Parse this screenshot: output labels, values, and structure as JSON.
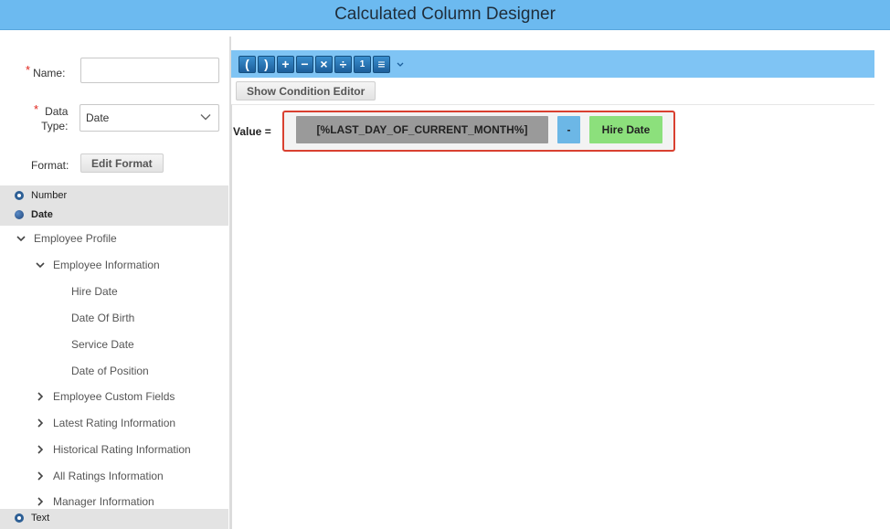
{
  "window": {
    "title": "Calculated Column Designer"
  },
  "form": {
    "name_label": "Name:",
    "name_value": "",
    "data_type_label_line1": "Data",
    "data_type_label_line2": "Type:",
    "data_type_value": "Date",
    "format_label": "Format:",
    "edit_format_button": "Edit Format"
  },
  "field_types": [
    {
      "label": "Number",
      "selected": false
    },
    {
      "label": "Date",
      "selected": true
    },
    {
      "label": "Text",
      "selected": false
    }
  ],
  "tree": {
    "root": "Employee Profile",
    "group": "Employee Information",
    "group_children": [
      "Hire Date",
      "Date Of Birth",
      "Service Date",
      "Date of Position"
    ],
    "collapsed_groups": [
      "Employee Custom Fields",
      "Latest Rating Information",
      "Historical Rating Information",
      "All Ratings Information",
      "Manager Information"
    ]
  },
  "toolbar": {
    "buttons": [
      {
        "icon": "open-paren-icon",
        "glyph": "("
      },
      {
        "icon": "close-paren-icon",
        "glyph": ")"
      },
      {
        "icon": "plus-icon",
        "glyph": "+"
      },
      {
        "icon": "minus-icon",
        "glyph": "−"
      },
      {
        "icon": "multiply-icon",
        "glyph": "×"
      },
      {
        "icon": "divide-icon",
        "glyph": "÷"
      },
      {
        "icon": "number-icon",
        "glyph": "1"
      },
      {
        "icon": "text-value-icon",
        "glyph": "≡"
      }
    ],
    "show_condition_editor": "Show Condition Editor"
  },
  "expression": {
    "value_label": "Value =",
    "variable_token": "[%LAST_DAY_OF_CURRENT_MONTH%]",
    "operator_token": "-",
    "field_token": "Hire Date"
  },
  "colors": {
    "title_bar": "#6cbaf0",
    "toolbar": "#7fc4f4",
    "highlight_border": "#d94030",
    "field_token": "#8ce07c",
    "operator_token": "#6cb7e6",
    "variable_token": "#9a9a9a"
  }
}
